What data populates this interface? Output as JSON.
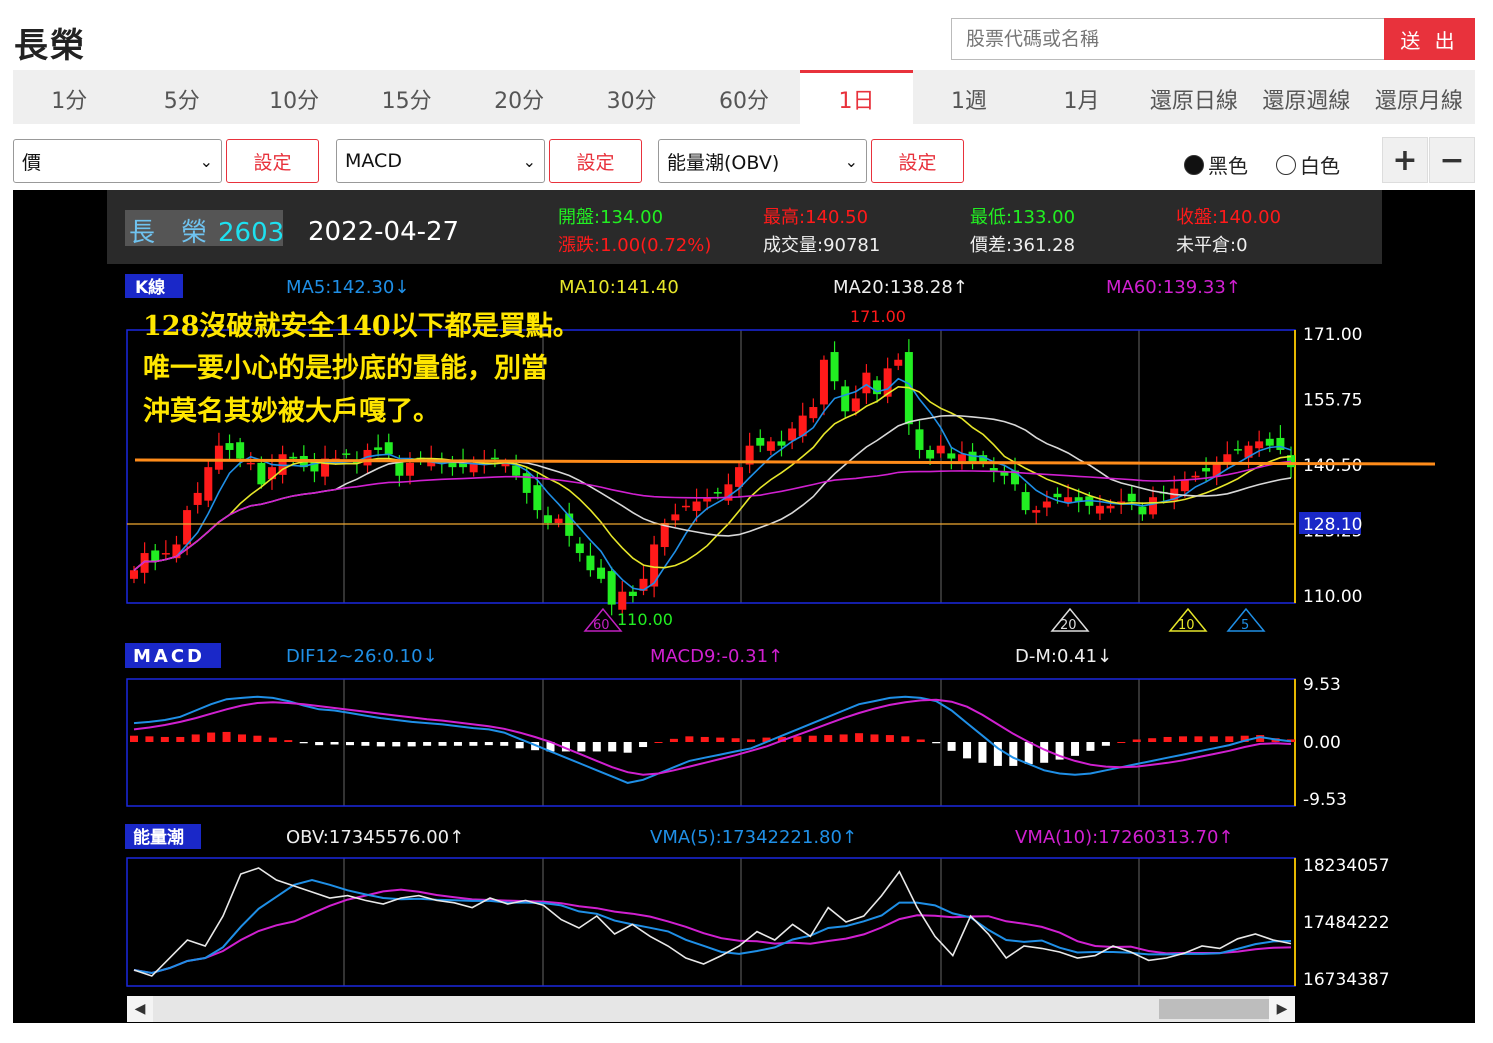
{
  "header": {
    "title": "長榮",
    "search_placeholder": "股票代碼或名稱",
    "submit_label": "送 出"
  },
  "tabs": [
    {
      "label": "1分",
      "active": false
    },
    {
      "label": "5分",
      "active": false
    },
    {
      "label": "10分",
      "active": false
    },
    {
      "label": "15分",
      "active": false
    },
    {
      "label": "20分",
      "active": false
    },
    {
      "label": "30分",
      "active": false
    },
    {
      "label": "60分",
      "active": false
    },
    {
      "label": "1日",
      "active": true
    },
    {
      "label": "1週",
      "active": false
    },
    {
      "label": "1月",
      "active": false
    },
    {
      "label": "還原日線",
      "active": false
    },
    {
      "label": "還原週線",
      "active": false
    },
    {
      "label": "還原月線",
      "active": false
    }
  ],
  "controls": {
    "selects": [
      "價",
      "MACD",
      "能量潮(OBV)"
    ],
    "set_label": "設定",
    "theme_black": "黑色",
    "theme_white": "白色",
    "theme_selected": "黑色",
    "zoom_in": "+",
    "zoom_out": "−"
  },
  "quote": {
    "name": "長　榮",
    "code": "2603",
    "date": "2022-04-27",
    "open": "開盤:134.00",
    "high": "最高:140.50",
    "low": "最低:133.00",
    "close": "收盤:140.00",
    "change": "漲跌:1.00(0.72%)",
    "volume": "成交量:90781",
    "spread": "價差:361.28",
    "open_interest": "未平倉:0"
  },
  "colors": {
    "up": "#ff1a1a",
    "down": "#22ee22",
    "ma5": "#1f8fe6",
    "ma10": "#e6e62a",
    "ma20": "#d8d8d8",
    "ma60": "#d020d0",
    "annotation_line": "#ff8c1a",
    "annotation_text": "#ffe600"
  },
  "annotation": {
    "lines": [
      "128沒破就安全140以下都是買點。",
      "唯一要小心的是抄底的量能，別當",
      "沖莫名其妙被大戶嘎了。"
    ],
    "line_price": 141.2
  },
  "kline": {
    "label": "K線",
    "ma5": "MA5:142.30↓",
    "ma10": "MA10:141.40",
    "ma20": "MA20:138.28↑",
    "ma60": "MA60:139.33↑",
    "y_ticks": [
      "171.00",
      "155.75",
      "140.50",
      "125.25",
      "110.00"
    ],
    "current_price_label": "128.10",
    "high_mark": "171.00",
    "low_mark": "110.00",
    "ma_badges": [
      "60",
      "20",
      "10",
      "5"
    ]
  },
  "macd": {
    "label": "MACD",
    "dif": "DIF12~26:0.10↓",
    "macd9": "MACD9:-0.31↑",
    "dm": "D-M:0.41↓",
    "y_ticks": [
      "9.53",
      "0.00",
      "-9.53"
    ]
  },
  "obv": {
    "label": "能量潮",
    "obv": "OBV:17345576.00↑",
    "vma5": "VMA(5):17342221.80↑",
    "vma10": "VMA(10):17260313.70↑",
    "y_ticks": [
      "18234057",
      "17484222",
      "16734387"
    ]
  },
  "scroll": {
    "left_arrow": "◀",
    "right_arrow": "▶"
  },
  "chart_data": {
    "type": "candlestick",
    "price_range": [
      110,
      171
    ],
    "closes": [
      116,
      120,
      118,
      120,
      122,
      130,
      134,
      140,
      145,
      144,
      142,
      141,
      136,
      140,
      143,
      142,
      140,
      139,
      142,
      142,
      143,
      141,
      144,
      144,
      143,
      138,
      141,
      142,
      142,
      141,
      140,
      140,
      141,
      141,
      142,
      141,
      138,
      134,
      130,
      127,
      128,
      124,
      120,
      116,
      114,
      108,
      111,
      110,
      114,
      122,
      127,
      129,
      131,
      132,
      133,
      134,
      136,
      140,
      145,
      145,
      146,
      145,
      149,
      152,
      154,
      165,
      160,
      153,
      156,
      162,
      157,
      163,
      165,
      150,
      144,
      142,
      145,
      142,
      143,
      141,
      141,
      139,
      138,
      136,
      130,
      130,
      132,
      133,
      133,
      132,
      131,
      131,
      131,
      132,
      132,
      129,
      133,
      134,
      135,
      137,
      138,
      139,
      141,
      143,
      144,
      145,
      146,
      145,
      144,
      140
    ],
    "macd_dif": [
      3,
      3.2,
      3.5,
      4,
      5,
      6,
      6.8,
      7,
      7.2,
      7,
      6.5,
      5.8,
      5.2,
      5,
      4.6,
      4.2,
      3.8,
      3.5,
      3.2,
      3,
      2.8,
      2.5,
      2.2,
      2,
      1.5,
      0.5,
      -0.5,
      -1.5,
      -2.5,
      -3.5,
      -4.5,
      -5.5,
      -6.5,
      -6,
      -5,
      -4,
      -3,
      -2.5,
      -2,
      -1.5,
      -1,
      0,
      1,
      2,
      3,
      4,
      5,
      6,
      6.5,
      7,
      7.2,
      7,
      6.5,
      5,
      3,
      1,
      -1,
      -2.5,
      -3.5,
      -4.5,
      -5,
      -5.2,
      -5,
      -4.5,
      -4,
      -3.5,
      -3,
      -2.5,
      -2,
      -1.5,
      -1,
      -0.5,
      0.2,
      0.8,
      0.4,
      0.1
    ],
    "macd_sig": [
      2,
      2.3,
      2.7,
      3.2,
      3.8,
      4.5,
      5.2,
      5.8,
      6.2,
      6.3,
      6.2,
      6,
      5.7,
      5.4,
      5.1,
      4.8,
      4.5,
      4.2,
      3.9,
      3.6,
      3.4,
      3.1,
      2.8,
      2.5,
      2.1,
      1.5,
      0.8,
      0,
      -1,
      -2,
      -3,
      -4,
      -4.8,
      -5.2,
      -5,
      -4.5,
      -3.9,
      -3.3,
      -2.7,
      -2.1,
      -1.4,
      -0.7,
      0.2,
      1.1,
      2,
      2.9,
      3.8,
      4.6,
      5.3,
      5.9,
      6.3,
      6.6,
      6.7,
      6.4,
      5.6,
      4.3,
      2.8,
      1.3,
      0,
      -1.2,
      -2.2,
      -3,
      -3.6,
      -3.9,
      -4,
      -3.9,
      -3.6,
      -3.3,
      -2.9,
      -2.4,
      -1.9,
      -1.4,
      -0.8,
      -0.3,
      -0.2,
      -0.31
    ],
    "obv_range": [
      16734387,
      18234057
    ],
    "obv": [
      0.1,
      0.05,
      0.2,
      0.35,
      0.3,
      0.55,
      0.9,
      0.95,
      0.85,
      0.8,
      0.75,
      0.7,
      0.72,
      0.68,
      0.65,
      0.7,
      0.72,
      0.68,
      0.66,
      0.62,
      0.7,
      0.65,
      0.68,
      0.64,
      0.52,
      0.45,
      0.55,
      0.4,
      0.48,
      0.38,
      0.3,
      0.2,
      0.15,
      0.22,
      0.3,
      0.42,
      0.35,
      0.48,
      0.38,
      0.62,
      0.5,
      0.55,
      0.72,
      0.92,
      0.62,
      0.38,
      0.22,
      0.55,
      0.4,
      0.2,
      0.3,
      0.28,
      0.25,
      0.2,
      0.22,
      0.3,
      0.25,
      0.18,
      0.2,
      0.24,
      0.3,
      0.28,
      0.36,
      0.4,
      0.35,
      0.32
    ]
  }
}
